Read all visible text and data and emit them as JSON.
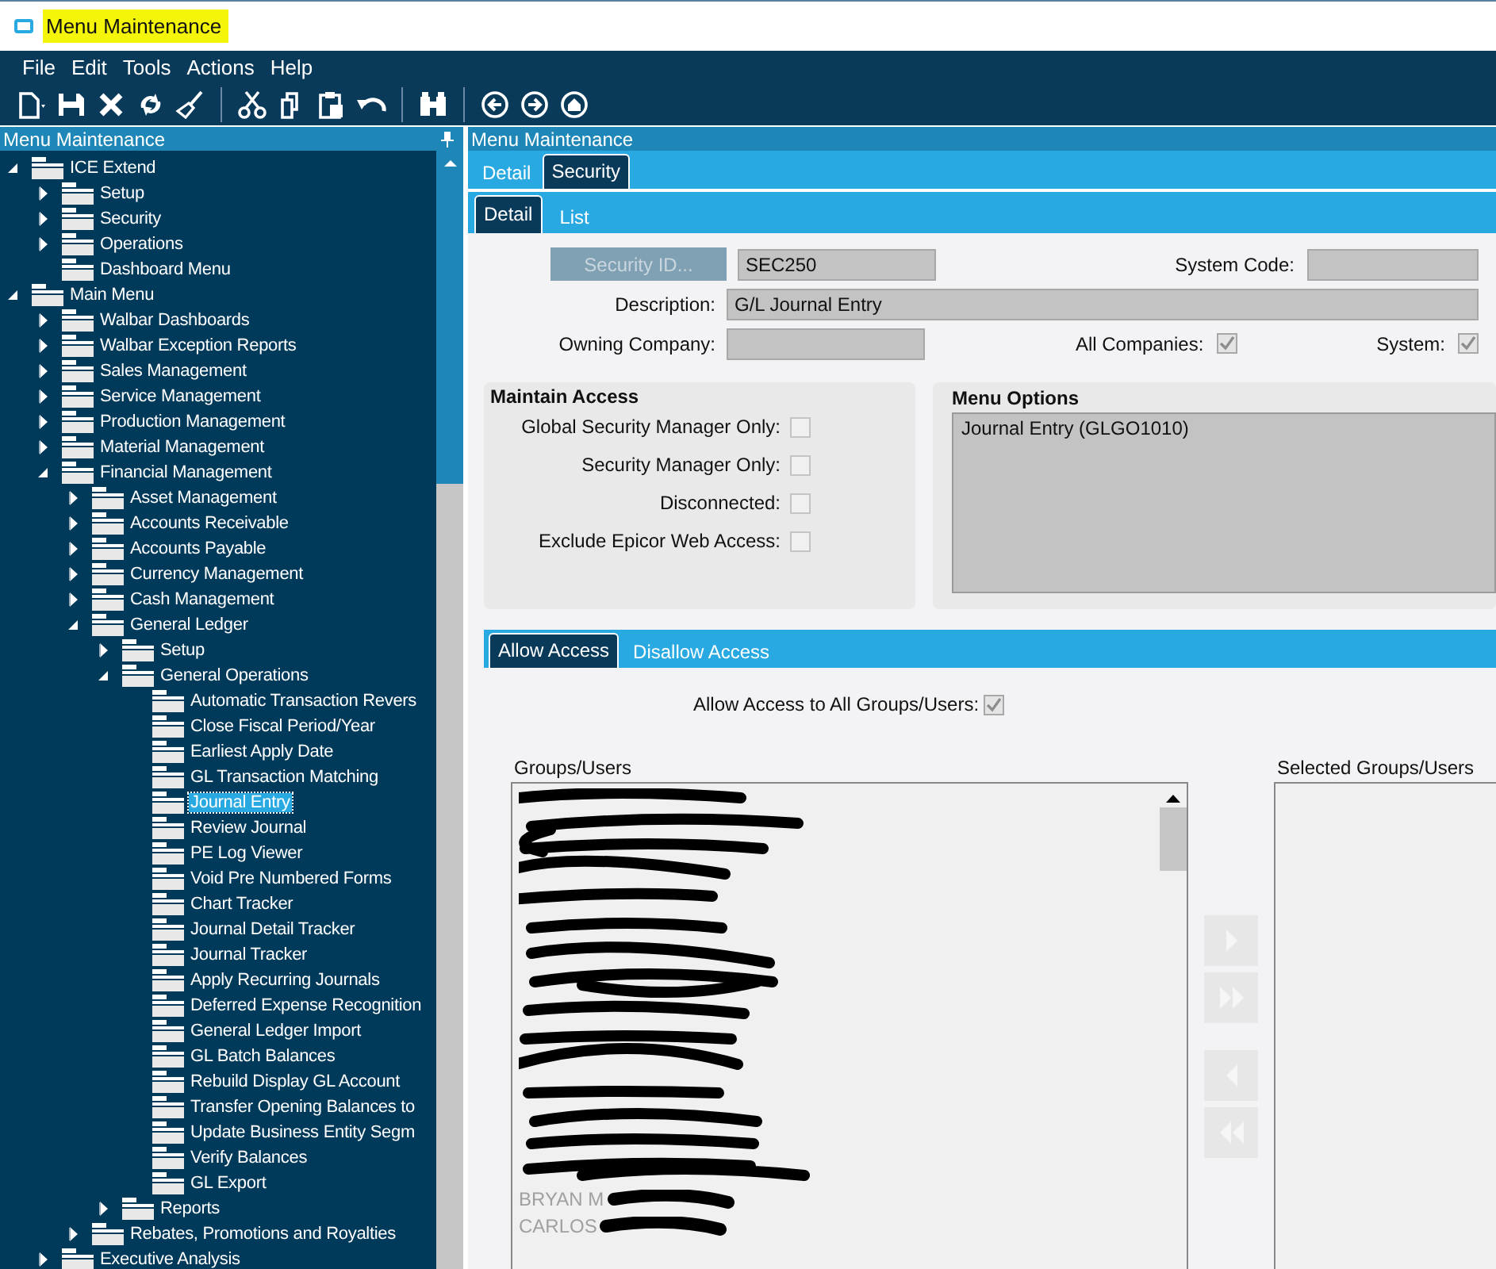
{
  "window": {
    "title": "Menu Maintenance"
  },
  "menu": [
    "File",
    "Edit",
    "Tools",
    "Actions",
    "Help"
  ],
  "toolbar": [
    {
      "kind": "new"
    },
    {
      "kind": "save"
    },
    {
      "kind": "delete"
    },
    {
      "kind": "refresh"
    },
    {
      "kind": "clear"
    },
    {
      "kind": "sep"
    },
    {
      "kind": "cut"
    },
    {
      "kind": "copy"
    },
    {
      "kind": "paste"
    },
    {
      "kind": "undo"
    },
    {
      "kind": "sep"
    },
    {
      "kind": "find"
    },
    {
      "kind": "sep"
    },
    {
      "kind": "back"
    },
    {
      "kind": "forward"
    },
    {
      "kind": "home"
    }
  ],
  "tree_panel": {
    "title": "Menu Maintenance",
    "nodes": [
      {
        "label": "ICE Extend",
        "expanded": true,
        "selected": false,
        "children": [
          {
            "label": "Setup",
            "expanded": false,
            "selected": false
          },
          {
            "label": "Security",
            "expanded": false,
            "selected": false
          },
          {
            "label": "Operations",
            "expanded": false,
            "selected": false
          },
          {
            "label": "Dashboard Menu",
            "selected": false
          }
        ]
      },
      {
        "label": "Main Menu",
        "expanded": true,
        "selected": false,
        "children": [
          {
            "label": "Walbar Dashboards",
            "expanded": false,
            "selected": false
          },
          {
            "label": "Walbar Exception Reports",
            "expanded": false,
            "selected": false
          },
          {
            "label": "Sales Management",
            "expanded": false,
            "selected": false
          },
          {
            "label": "Service Management",
            "expanded": false,
            "selected": false
          },
          {
            "label": "Production Management",
            "expanded": false,
            "selected": false
          },
          {
            "label": "Material Management",
            "expanded": false,
            "selected": false
          },
          {
            "label": "Financial Management",
            "expanded": true,
            "selected": false,
            "children": [
              {
                "label": "Asset Management",
                "expanded": false,
                "selected": false
              },
              {
                "label": "Accounts Receivable",
                "expanded": false,
                "selected": false
              },
              {
                "label": "Accounts Payable",
                "expanded": false,
                "selected": false
              },
              {
                "label": "Currency Management",
                "expanded": false,
                "selected": false
              },
              {
                "label": "Cash Management",
                "expanded": false,
                "selected": false
              },
              {
                "label": "General Ledger",
                "expanded": true,
                "selected": false,
                "children": [
                  {
                    "label": "Setup",
                    "expanded": false,
                    "selected": false
                  },
                  {
                    "label": "General Operations",
                    "expanded": true,
                    "selected": false,
                    "children": [
                      {
                        "label": "Automatic Transaction Revers",
                        "selected": false
                      },
                      {
                        "label": "Close Fiscal Period/Year",
                        "selected": false
                      },
                      {
                        "label": "Earliest Apply Date",
                        "selected": false
                      },
                      {
                        "label": "GL Transaction Matching",
                        "selected": false
                      },
                      {
                        "label": "Journal Entry",
                        "selected": true
                      },
                      {
                        "label": "Review Journal",
                        "selected": false
                      },
                      {
                        "label": "PE Log Viewer",
                        "selected": false
                      },
                      {
                        "label": "Void Pre Numbered Forms",
                        "selected": false
                      },
                      {
                        "label": "Chart Tracker",
                        "selected": false
                      },
                      {
                        "label": "Journal Detail Tracker",
                        "selected": false
                      },
                      {
                        "label": "Journal Tracker",
                        "selected": false
                      },
                      {
                        "label": "Apply Recurring Journals",
                        "selected": false
                      },
                      {
                        "label": "Deferred Expense Recognition",
                        "selected": false
                      },
                      {
                        "label": "General Ledger Import",
                        "selected": false
                      },
                      {
                        "label": "GL Batch Balances",
                        "selected": false
                      },
                      {
                        "label": "Rebuild Display GL Account",
                        "selected": false
                      },
                      {
                        "label": "Transfer Opening Balances to",
                        "selected": false
                      },
                      {
                        "label": "Update Business Entity Segm",
                        "selected": false
                      },
                      {
                        "label": "Verify Balances",
                        "selected": false
                      },
                      {
                        "label": "GL Export",
                        "selected": false
                      }
                    ]
                  },
                  {
                    "label": "Reports",
                    "expanded": false,
                    "selected": false
                  }
                ]
              },
              {
                "label": "Rebates, Promotions and Royalties",
                "expanded": false,
                "selected": false
              }
            ]
          },
          {
            "label": "Executive Analysis",
            "expanded": false,
            "selected": false
          }
        ]
      }
    ]
  },
  "main": {
    "title": "Menu Maintenance",
    "tabs": [
      {
        "label": "Detail",
        "selected": false
      },
      {
        "label": "Security",
        "selected": true
      }
    ],
    "subtabs": [
      {
        "label": "Detail",
        "selected": true
      },
      {
        "label": "List",
        "selected": false
      }
    ],
    "form": {
      "security_id_button": "Security ID...",
      "security_id": "SEC250",
      "system_code_label": "System Code:",
      "description_label": "Description:",
      "description": "G/L Journal Entry",
      "owning_company_label": "Owning Company:",
      "all_companies": {
        "label": "All Companies:",
        "checked": true
      },
      "system": {
        "label": "System:",
        "checked": true
      }
    },
    "maintain_access": {
      "title": "Maintain Access",
      "options": [
        {
          "label": "Global Security Manager Only:",
          "checked": false
        },
        {
          "label": "Security Manager Only:",
          "checked": false
        },
        {
          "label": "Disconnected:",
          "checked": false
        },
        {
          "label": "Exclude Epicor Web Access:",
          "checked": false
        }
      ]
    },
    "menu_options": {
      "title": "Menu Options",
      "items": [
        "Journal Entry (GLGO1010)"
      ]
    },
    "access_tabs": [
      {
        "label": "Allow Access",
        "selected": true
      },
      {
        "label": "Disallow Access",
        "selected": false
      }
    ],
    "allow_all": {
      "label": "Allow Access to All Groups/Users:",
      "checked": true
    },
    "groups": {
      "title": "Groups/Users",
      "rows": [
        "BRYAN M",
        "CARLOS"
      ]
    },
    "transfer_buttons": [
      {
        "kind": "add",
        "disabled": true
      },
      {
        "kind": "add_all",
        "disabled": true
      },
      {
        "kind": "remove",
        "disabled": true
      },
      {
        "kind": "remove_all",
        "disabled": true
      }
    ],
    "selected_groups": {
      "title": "Selected Groups/Users"
    }
  }
}
